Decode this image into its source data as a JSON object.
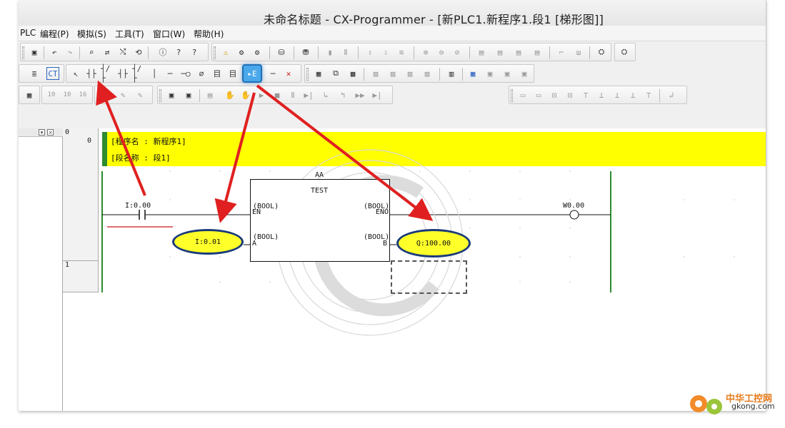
{
  "window": {
    "title": "未命名标题 - CX-Programmer - [新PLC1.新程序1.段1 [梯形图]]"
  },
  "menu": {
    "items": [
      {
        "label": "PLC"
      },
      {
        "label": "编程(P)"
      },
      {
        "label": "模拟(S)"
      },
      {
        "label": "工具(T)"
      },
      {
        "label": "窗口(W)"
      },
      {
        "label": "帮助(H)"
      }
    ]
  },
  "toolbar": {
    "row2_highlighted_tool": "function-block-call-icon"
  },
  "ladder": {
    "rungs": [
      {
        "number": "0",
        "address": "0"
      },
      {
        "number": "1",
        "address": ""
      }
    ],
    "program_comment": "[程序名 : 新程序1]",
    "section_comment": "[段名称 : 段1]",
    "instance_name": "AA",
    "fb_name": "TEST",
    "contact_address": "I:0.00",
    "coil_address": "W0.00",
    "fb_in_en": "(BOOL)",
    "fb_in_en_name": "EN",
    "fb_in_a": "(BOOL)",
    "fb_in_a_name": "A",
    "fb_out_eno": "(BOOL)",
    "fb_out_eno_name": "ENO",
    "fb_out_b": "(BOOL)",
    "fb_out_b_name": "B",
    "input_param": "I:0.01",
    "output_param": "Q:100.00"
  },
  "watermark": {
    "site_name": "中华工控网",
    "site_url": "gkong.com"
  },
  "colors": {
    "comment_band": "#ffff00",
    "annotation_arrow": "#e02020",
    "oval_fill": "#ffff2a",
    "oval_border": "#1a3a7a",
    "power_rail": "#2e8b2e"
  }
}
